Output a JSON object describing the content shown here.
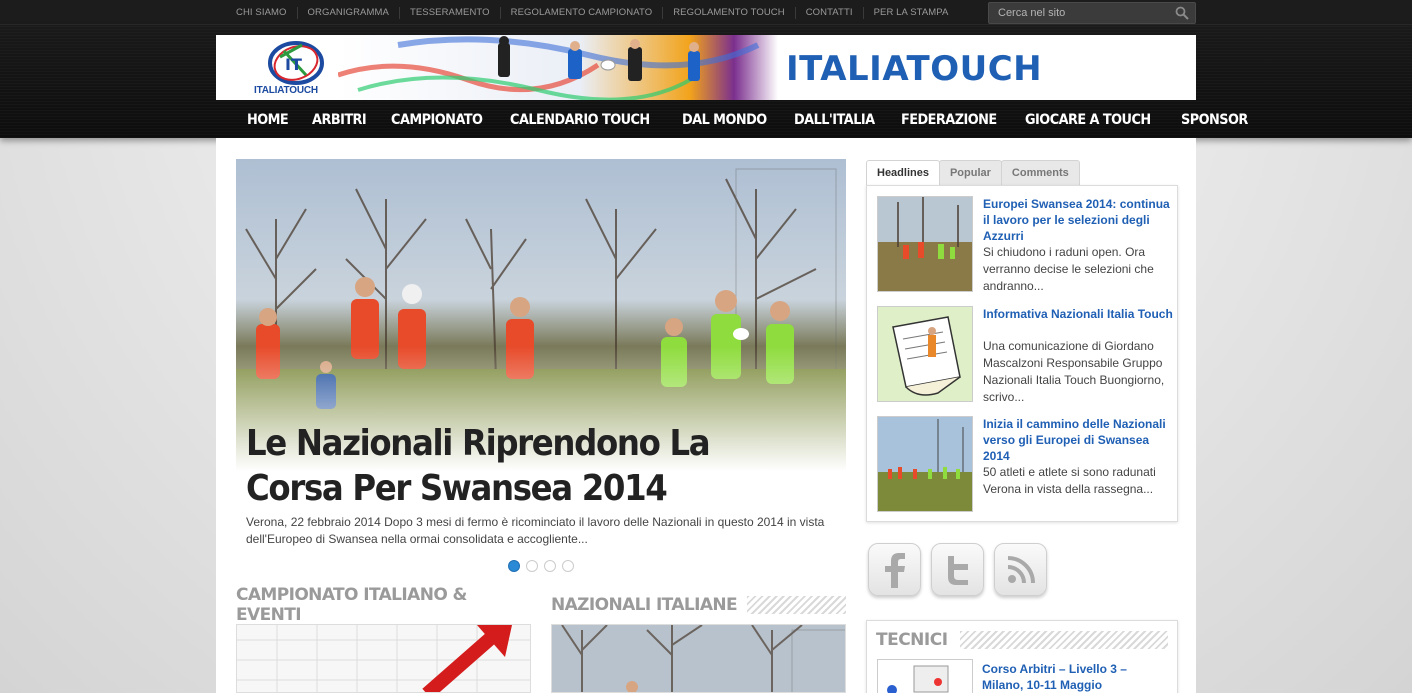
{
  "topnav": {
    "items": [
      "CHI SIAMO",
      "ORGANIGRAMMA",
      "TESSERAMENTO",
      "REGOLAMENTO CAMPIONATO",
      "REGOLAMENTO TOUCH",
      "CONTATTI",
      "PER LA STAMPA"
    ]
  },
  "search": {
    "placeholder": "Cerca nel sito",
    "icon": "search-icon"
  },
  "banner": {
    "logo_text": "ITALIATOUCH",
    "wordmark": "ITALIATOUCH"
  },
  "mainnav": {
    "items": [
      "HOME",
      "ARBITRI",
      "CAMPIONATO",
      "CALENDARIO TOUCH",
      "DAL MONDO",
      "DALL'ITALIA",
      "FEDERAZIONE",
      "GIOCARE A TOUCH",
      "SPONSOR"
    ]
  },
  "slider": {
    "title": "Le Nazionali Riprendono La Corsa Per Swansea 2014",
    "excerpt": "Verona, 22 febbraio 2014 Dopo 3 mesi di fermo è ricominciato il lavoro delle Nazionali in questo 2014 in vista dell'Europeo di Swansea nella ormai consolidata e accogliente...",
    "slide_count": 4,
    "active_slide": 1
  },
  "sections": {
    "left_title": "CAMPIONATO ITALIANO & EVENTI",
    "right_title": "NAZIONALI ITALIANE"
  },
  "sidebar": {
    "tabs": [
      "Headlines",
      "Popular",
      "Comments"
    ],
    "active_tab": "Headlines",
    "headlines": [
      {
        "title": "Europei Swansea 2014: continua il lavoro per le selezioni degli Azzurri",
        "excerpt": "Si chiudono i raduni open. Ora verranno decise le selezioni che andranno..."
      },
      {
        "title": "Informativa Nazionali Italia Touch",
        "excerpt": "Una comunicazione di Giordano Mascalzoni Responsabile Gruppo Nazionali Italia Touch Buongiorno, scrivo..."
      },
      {
        "title": "Inizia il cammino delle Nazionali verso gli Europei di Swansea 2014",
        "excerpt": "50 atleti e atlete si sono radunati Verona in vista della rassegna..."
      }
    ],
    "social": [
      "facebook-icon",
      "twitter-icon",
      "rss-icon"
    ],
    "tecnici": {
      "title": "TECNICI",
      "item_title": "Corso Arbitri – Livello 3 – Milano, 10-11 Maggio"
    }
  },
  "colors": {
    "link_blue": "#1f5fb4",
    "dot_active": "#2b8ad6",
    "header_bg": "#111111"
  }
}
